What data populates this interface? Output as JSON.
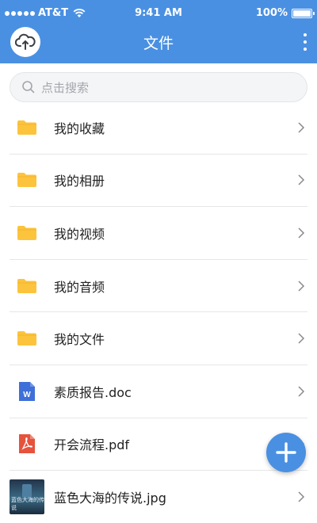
{
  "status_bar": {
    "carrier": "AT&T",
    "time": "9:41 AM",
    "battery": "100%"
  },
  "header": {
    "title": "文件",
    "accent_color": "#4a90e2"
  },
  "search": {
    "placeholder": "点击搜索"
  },
  "files": [
    {
      "label": "我的收藏",
      "icon": "folder-icon"
    },
    {
      "label": "我的相册",
      "icon": "folder-icon"
    },
    {
      "label": "我的视频",
      "icon": "folder-icon"
    },
    {
      "label": "我的音频",
      "icon": "folder-icon"
    },
    {
      "label": "我的文件",
      "icon": "folder-icon"
    },
    {
      "label": "素质报告.doc",
      "icon": "word-doc-icon"
    },
    {
      "label": "开会流程.pdf",
      "icon": "pdf-icon"
    },
    {
      "label": "蓝色大海的传说.jpg",
      "icon": "image-thumbnail",
      "thumb_text": "蓝色大海的传说"
    }
  ]
}
